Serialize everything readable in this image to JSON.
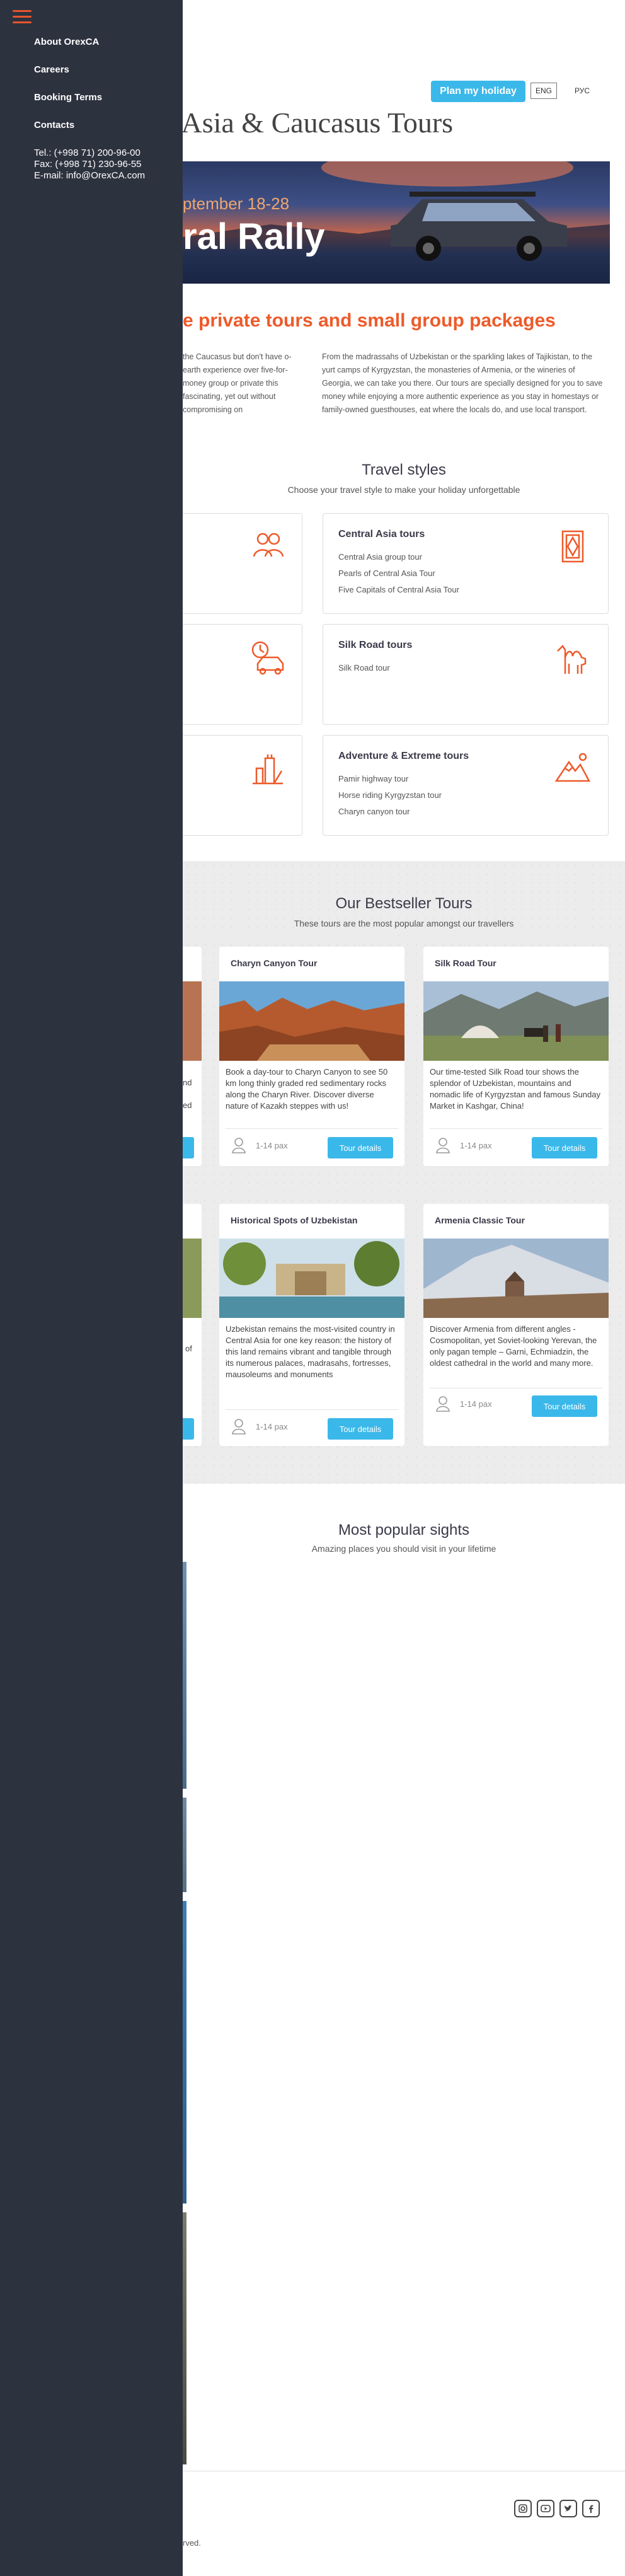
{
  "sidebar": {
    "items": [
      {
        "label": "About OrexCA"
      },
      {
        "label": "Careers"
      },
      {
        "label": "Booking Terms"
      },
      {
        "label": "Contacts"
      }
    ],
    "tel": "Tel.: (+998 71) 200-96-00",
    "fax": "Fax: (+998 71) 230-96-55",
    "email": "E-mail: info@OrexCA.com"
  },
  "header": {
    "plan_label": "Plan my holiday",
    "lang_eng": "ENG",
    "lang_rus": "РУС",
    "title": "ral Asia & Caucasus Tours"
  },
  "hero": {
    "date": "ptember 18-28",
    "title": "ral Rally"
  },
  "intro": {
    "heading": "e private tours and small group packages",
    "left_text": "the Caucasus but don't have o-earth experience over five-for-money group or private this fascinating, yet out without compromising on",
    "right_text": "From the madrassahs of Uzbekistan or the sparkling lakes of Tajikistan, to the yurt camps of Kyrgyzstan, the monasteries of Armenia, or the wineries of Georgia, we can take you there. Our tours are specially designed for you to save money while enjoying a more authentic experience as you stay in homestays or family-owned guesthouses, eat where the locals do, and use local transport."
  },
  "travel_styles": {
    "title": "Travel styles",
    "subtitle": "Choose your travel style to make your holiday unforgettable",
    "cards": [
      {
        "title": "Central Asia tours",
        "items": [
          "Central Asia group tour",
          "Pearls of Central Asia Tour",
          "Five Capitals of Central Asia Tour"
        ],
        "icon": "carpet-icon"
      },
      {
        "title": "Silk Road tours",
        "items": [
          "Silk Road tour"
        ],
        "icon": "camel-icon"
      },
      {
        "title": "Adventure & Extreme tours",
        "items": [
          "Pamir highway tour",
          "Horse riding Kyrgyzstan tour",
          "Charyn canyon tour"
        ],
        "icon": "mountains-icon"
      }
    ]
  },
  "bestsellers": {
    "title": "Our Bestseller Tours",
    "subtitle": "These tours are the most popular amongst our travellers",
    "pax": "1-14 pax",
    "button_label": "Tour details",
    "left_partial": {
      "line1": "nd",
      "line2": "ed",
      "line3": "of"
    },
    "tours": [
      {
        "title": "Charyn Canyon Tour",
        "desc": "Book a day-tour to Charyn Canyon to see 50 km long thinly graded red sedimentary rocks along the Charyn River. Discover diverse nature of Kazakh steppes with us!"
      },
      {
        "title": "Silk Road Tour",
        "desc": "Our time-tested Silk Road tour shows the splendor of Uzbekistan, mountains and nomadic life of Kyrgyzstan and famous Sunday Market in Kashgar, China!"
      },
      {
        "title": "Historical Spots of Uzbekistan",
        "desc": "Uzbekistan remains the most-visited country in Central Asia for one key reason: the history of this land remains vibrant and tangible through its numerous palaces, madrasahs, fortresses, mausoleums and monuments"
      },
      {
        "title": "Armenia Classic Tour",
        "desc": "Discover Armenia from different angles - Cosmopolitan, yet Soviet-looking Yerevan, the only pagan temple – Garni, Echmiadzin, the oldest cathedral in the world and many more."
      }
    ]
  },
  "sights": {
    "title": "Most popular sights",
    "subtitle": "Amazing places you should visit in your lifetime"
  },
  "footer": {
    "copyright": "rved.",
    "social": [
      "instagram-icon",
      "youtube-icon",
      "twitter-icon",
      "facebook-icon"
    ]
  },
  "colors": {
    "accent_orange": "#ee5a2a",
    "button_blue": "#3bb8ea",
    "sidebar_bg": "#2d323f"
  }
}
